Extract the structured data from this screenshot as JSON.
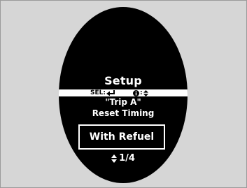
{
  "screen": {
    "title": "Setup",
    "selbar": {
      "sel_label": "SEL:",
      "enter_icon": "enter-arrow-icon",
      "info_icon": "info-icon",
      "info_colon": ":",
      "updown_icon": "up-down-arrows-icon"
    },
    "item_name": "\"Trip A\"",
    "item_sub": "Reset Timing",
    "selected_option": "With Refuel",
    "page_indicator": "1/4"
  },
  "colors": {
    "background_panel": "#d6d6d6",
    "display": "#000000",
    "text": "#ffffff",
    "selbar_bg": "#ffffff"
  }
}
